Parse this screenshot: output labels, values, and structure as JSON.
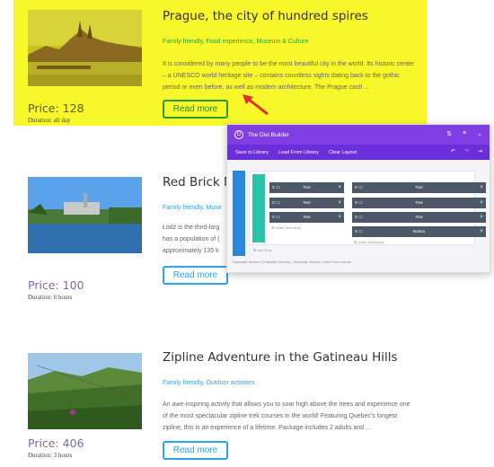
{
  "tours": [
    {
      "title": "Prague, the city of hundred spires",
      "tags": "Family friendly, Food experience, Museum & Culture",
      "description": "It is considered by many people to be the most beautiful city in the world. Its historic center – a UNESCO world heritage site – contains countless sights dating back to the gothic period or even before, as well as modern architecture. The Prague castl ...",
      "price": "Price: 128",
      "duration": "Duration: all day",
      "read_more": "Read more"
    },
    {
      "title": "Red Brick M",
      "tags": "Family friendly, Muse",
      "description_lines": [
        "Łódź is the third-larg",
        "has a population of (",
        "approximately 135 k"
      ],
      "price": "Price: 100",
      "duration": "Duration: 6 hours",
      "read_more": "Read more"
    },
    {
      "title": "Zipline Adventure in the Gatineau Hills",
      "tags": "Family friendly, Outdoor activities",
      "description": "An awe-inspiring activity that allows you to soar high above the trees and experience one of the most spectacular zipline trek courses in the world! Featuring Quebec's longest zipline, this is an experience of a lifetime. Package includes 2 adults and ...",
      "price": "Price: 406",
      "duration": "Duration: 3 hours",
      "read_more": "Read more"
    }
  ],
  "divi": {
    "title": "The Divi Builder",
    "logo": "D",
    "save_to_library": "Save to Library",
    "load_from_library": "Load From Library",
    "clear_layout": "Clear Layout",
    "module_left": [
      "Text",
      "Text",
      "Text"
    ],
    "module_right": [
      "Text",
      "Text",
      "Text",
      "Button"
    ],
    "insert_modules": "Insert Module(s)",
    "add_row": "Add Row",
    "footer": "Standard Section | Fullwidth Section | Specialty Section | Add From Library"
  },
  "icons": {
    "sort": "⇅",
    "menu": "≡",
    "collapse": "⌄",
    "undo": "↶",
    "redo": "↷",
    "exit": "⇥"
  },
  "colors": {
    "highlight": "#f8f72a",
    "link_blue": "#2ea3f2",
    "divi_purple": "#7f3fe3"
  }
}
